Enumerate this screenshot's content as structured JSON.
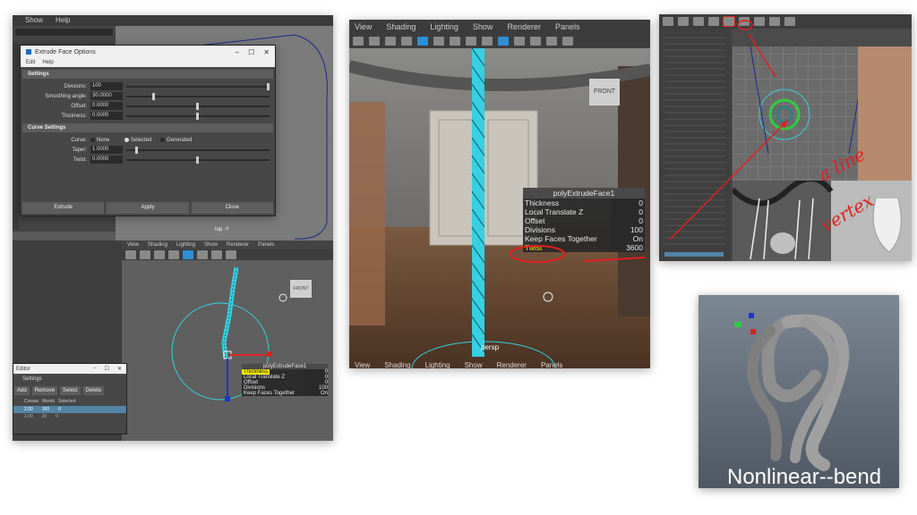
{
  "panel1": {
    "top_menu": [
      "Show",
      "Help"
    ],
    "dialog": {
      "title": "Extrude Face Options",
      "menu": [
        "Edit",
        "Help"
      ],
      "section_settings": "Settings",
      "fields": [
        {
          "label": "Divisions:",
          "value": "100"
        },
        {
          "label": "Smoothing angle:",
          "value": "30.0000"
        },
        {
          "label": "Offset:",
          "value": "0.0000"
        },
        {
          "label": "Thickness:",
          "value": "0.0000"
        }
      ],
      "section_curve": "Curve Settings",
      "curve_label": "Curve:",
      "curve_options": [
        "None",
        "Selected",
        "Generated"
      ],
      "curve_selected": "Selected",
      "curve_fields": [
        {
          "label": "Taper:",
          "value": "1.0000"
        },
        {
          "label": "Twist:",
          "value": "0.0000"
        }
      ],
      "buttons": [
        "Extrude",
        "Apply",
        "Close"
      ]
    },
    "top_view_label": "top -Y",
    "viewport_menu": [
      "View",
      "Shading",
      "Lighting",
      "Show",
      "Renderer",
      "Panels"
    ],
    "front_label": "FRONT",
    "editor": {
      "title": "Editor",
      "settings": "Settings",
      "buttons": [
        "Add",
        "Remove",
        "Select",
        "Delete"
      ],
      "columns": [
        "Crease",
        "Memb",
        "Selected"
      ],
      "rows": [
        [
          "2.00",
          "160",
          "0"
        ],
        [
          "2.00",
          "20",
          "0"
        ]
      ]
    },
    "node": {
      "title": "polyExtrudeFace1",
      "rows": [
        {
          "label": "Thickness",
          "value": "0"
        },
        {
          "label": "Local Translate Z",
          "value": "0"
        },
        {
          "label": "Offset",
          "value": "0"
        },
        {
          "label": "Divisions",
          "value": "100"
        },
        {
          "label": "Keep Faces Together",
          "value": "On"
        }
      ]
    }
  },
  "panel2": {
    "menu": [
      "View",
      "Shading",
      "Lighting",
      "Show",
      "Renderer",
      "Panels"
    ],
    "front_label": "FRONT",
    "node": {
      "title": "polyExtrudeFace1",
      "rows": [
        {
          "label": "Thickness",
          "value": "0"
        },
        {
          "label": "Local Translate Z",
          "value": "0"
        },
        {
          "label": "Offset",
          "value": "0"
        },
        {
          "label": "Divisions",
          "value": "100"
        },
        {
          "label": "Keep Faces Together",
          "value": "On"
        },
        {
          "label": "Twist",
          "value": "3600"
        }
      ]
    },
    "camera_label": "persp",
    "bottom_menu": [
      "View",
      "Shading",
      "Lighting",
      "Show",
      "Renderer",
      "Panels"
    ]
  },
  "panel3": {
    "annotation_line1": "a line",
    "annotation_line2": "vertex"
  },
  "panel4": {
    "caption": "Nonlinear--bend"
  },
  "colors": {
    "maya_dark": "#444444",
    "highlight_yellow": "#f5e600",
    "annotation_red": "#e02020",
    "selection_cyan": "#36d0e0"
  }
}
